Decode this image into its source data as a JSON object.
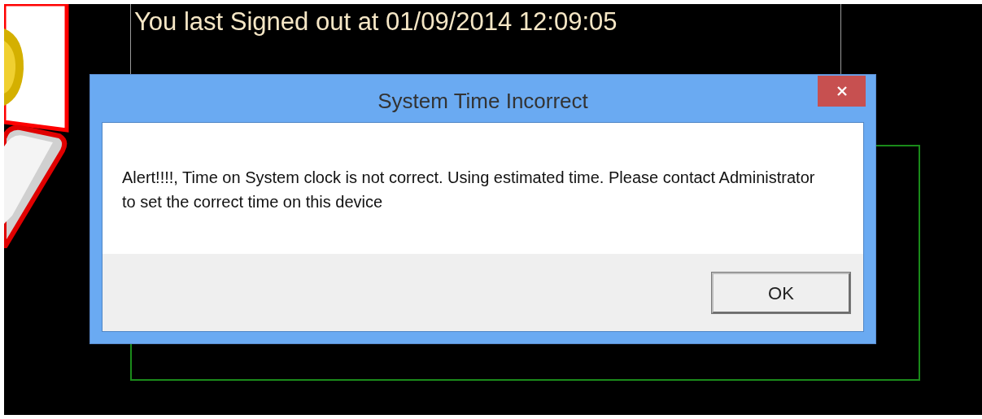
{
  "last_sign_out": "You last Signed out at 01/09/2014 12:09:05",
  "dialog": {
    "title": "System Time Incorrect",
    "message": "Alert!!!!, Time on System clock is not correct. Using estimated time. Please contact Administrator to set the correct time on this device",
    "buttons": [
      "OK"
    ]
  }
}
